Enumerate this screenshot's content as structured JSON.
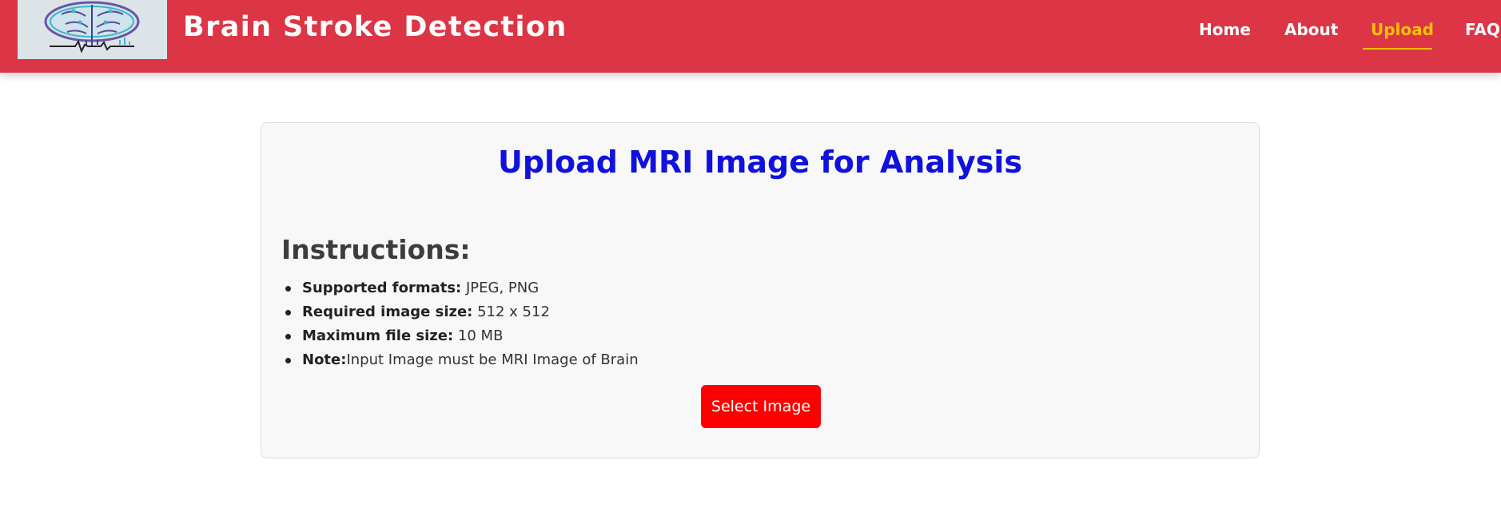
{
  "header": {
    "brand_title": "Brain Stroke Detection",
    "background_color": "#dc3545",
    "active_color": "#ffc107",
    "logo": {
      "icon": "brain-circuit-logo"
    },
    "nav": [
      {
        "label": "Home",
        "active": false
      },
      {
        "label": "About",
        "active": false
      },
      {
        "label": "Upload",
        "active": true
      },
      {
        "label": "FAQ",
        "active": false
      }
    ]
  },
  "upload_card": {
    "title": "Upload MRI Image for Analysis",
    "title_color": "#1111dd",
    "instructions_heading": "Instructions:",
    "instructions": [
      {
        "label": "Supported formats:",
        "value": " JPEG, PNG"
      },
      {
        "label": "Required image size:",
        "value": " 512 x 512"
      },
      {
        "label": "Maximum file size:",
        "value": " 10 MB"
      },
      {
        "label": "Note:",
        "value": "Input Image must be MRI Image of Brain"
      }
    ],
    "select_button_label": "Select Image",
    "select_button_color": "#ff0000"
  }
}
